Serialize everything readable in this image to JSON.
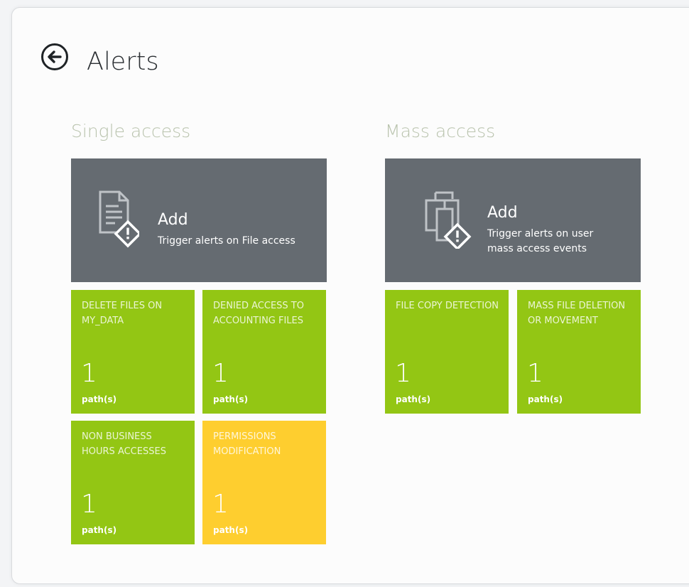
{
  "header": {
    "title": "Alerts"
  },
  "colors": {
    "tile_green": "#93c614",
    "tile_yellow": "#fece2f",
    "add_tile_gray": "#656b71",
    "section_title": "#b9c3ad"
  },
  "single": {
    "section_title": "Single access",
    "add": {
      "label": "Add",
      "description": "Trigger alerts on File access",
      "icon": "file-alert-icon"
    },
    "tiles": [
      {
        "name": "DELETE FILES ON MY_DATA",
        "count": "1",
        "unit": "path(s)",
        "color": "green"
      },
      {
        "name": "DENIED ACCESS TO ACCOUNTING FILES",
        "count": "1",
        "unit": "path(s)",
        "color": "green"
      },
      {
        "name": "NON BUSINESS HOURS ACCESSES",
        "count": "1",
        "unit": "path(s)",
        "color": "green"
      },
      {
        "name": "PERMISSIONS MODIFICATION",
        "count": "1",
        "unit": "path(s)",
        "color": "yellow"
      }
    ]
  },
  "mass": {
    "section_title": "Mass access",
    "add": {
      "label": "Add",
      "description_line1": "Trigger alerts on user",
      "description_line2": "mass access events",
      "icon": "multi-file-alert-icon"
    },
    "tiles": [
      {
        "name": "FILE COPY DETECTION",
        "count": "1",
        "unit": "path(s)",
        "color": "green"
      },
      {
        "name": "MASS FILE DELETION OR MOVEMENT",
        "count": "1",
        "unit": "path(s)",
        "color": "green"
      }
    ]
  }
}
